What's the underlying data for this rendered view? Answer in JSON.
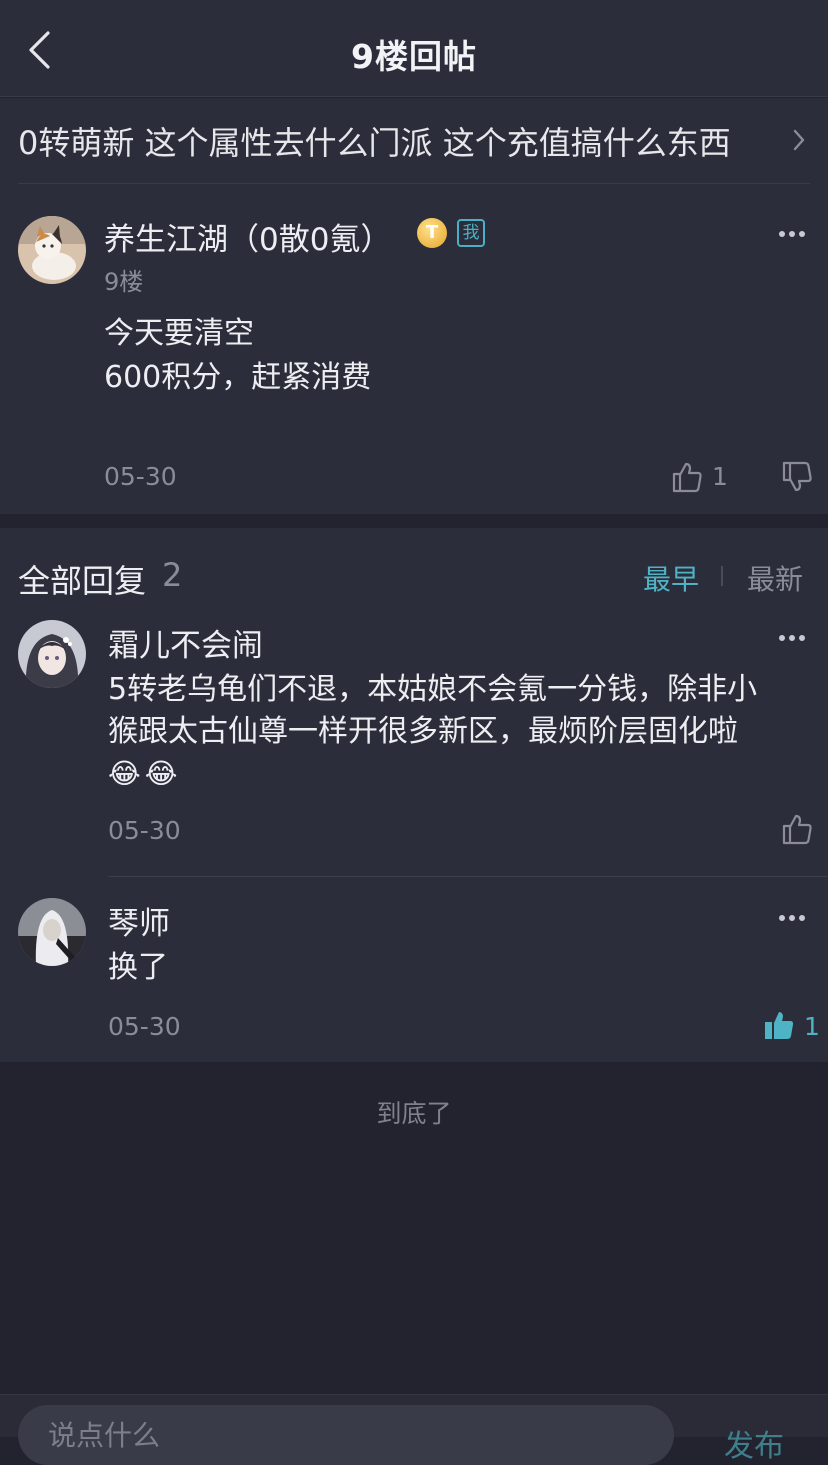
{
  "header": {
    "title": "9楼回帖"
  },
  "thread": {
    "title": "0转萌新 这个属性去什么门派 这个充值搞什么东西"
  },
  "post": {
    "author": "养生江湖（0散0氪）",
    "badge_coin": "T",
    "badge_me": "我",
    "floor": "9楼",
    "lines": [
      "今天要清空",
      "600积分，赶紧消费"
    ],
    "date": "05-30",
    "likes": "1"
  },
  "replies_header": {
    "title": "全部回复",
    "count": "2",
    "sort_earliest": "最早",
    "sort_latest": "最新"
  },
  "replies": [
    {
      "author": "霜儿不会闹",
      "lines": [
        "5转老乌龟们不退，本姑娘不会氪一分钱，除非小",
        "猴跟太古仙尊一样开很多新区，最烦阶层固化啦"
      ],
      "emoji": "😂😂",
      "date": "05-30"
    },
    {
      "author": "琴师",
      "text": "换了",
      "date": "05-30",
      "likes": "1"
    }
  ],
  "footer": {
    "end_text": "到底了"
  },
  "bottom_bar": {
    "placeholder": "说点什么",
    "send_label": "发布"
  },
  "colors": {
    "accent": "#4fb3c6",
    "background": "#22232f",
    "card": "#2c2d3a",
    "badge_coin": "#e4a52a"
  }
}
